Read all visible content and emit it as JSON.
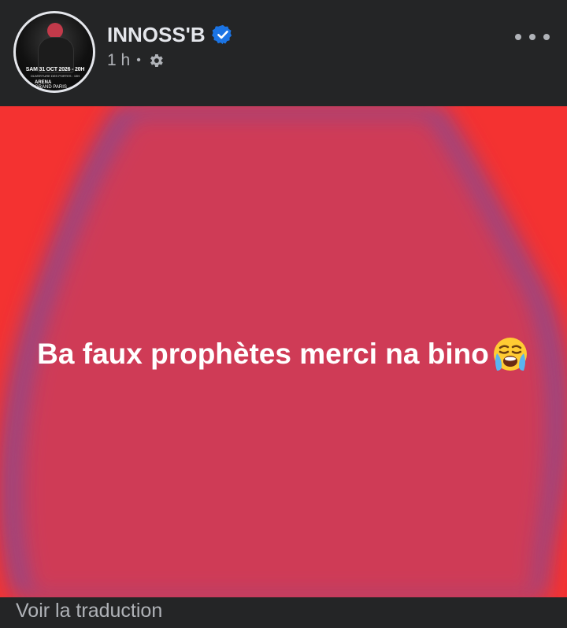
{
  "post": {
    "author": {
      "name": "INNOSS'B",
      "verified": true,
      "avatar_text": {
        "line1": "SAM 31 OCT 2026 - 20H",
        "line2": "OUVERTURE DES PORTES : 19H",
        "line3": "ARENA",
        "line4": "GRAND PARIS"
      }
    },
    "timestamp": "1 h",
    "separator": "•",
    "privacy_icon": "gear-icon",
    "more_icon": "more-dots-icon",
    "content": {
      "text": "Ba faux prophètes merci na bino",
      "emoji": "loudly-crying-face-icon",
      "background_color": "#f43231",
      "blob_color": "#cf3b56"
    },
    "translate_label": "Voir la traduction"
  },
  "colors": {
    "background": "#242526",
    "primary_text": "#e4e6eb",
    "secondary_text": "#b0b3b8",
    "verified_blue": "#1b74e4"
  }
}
